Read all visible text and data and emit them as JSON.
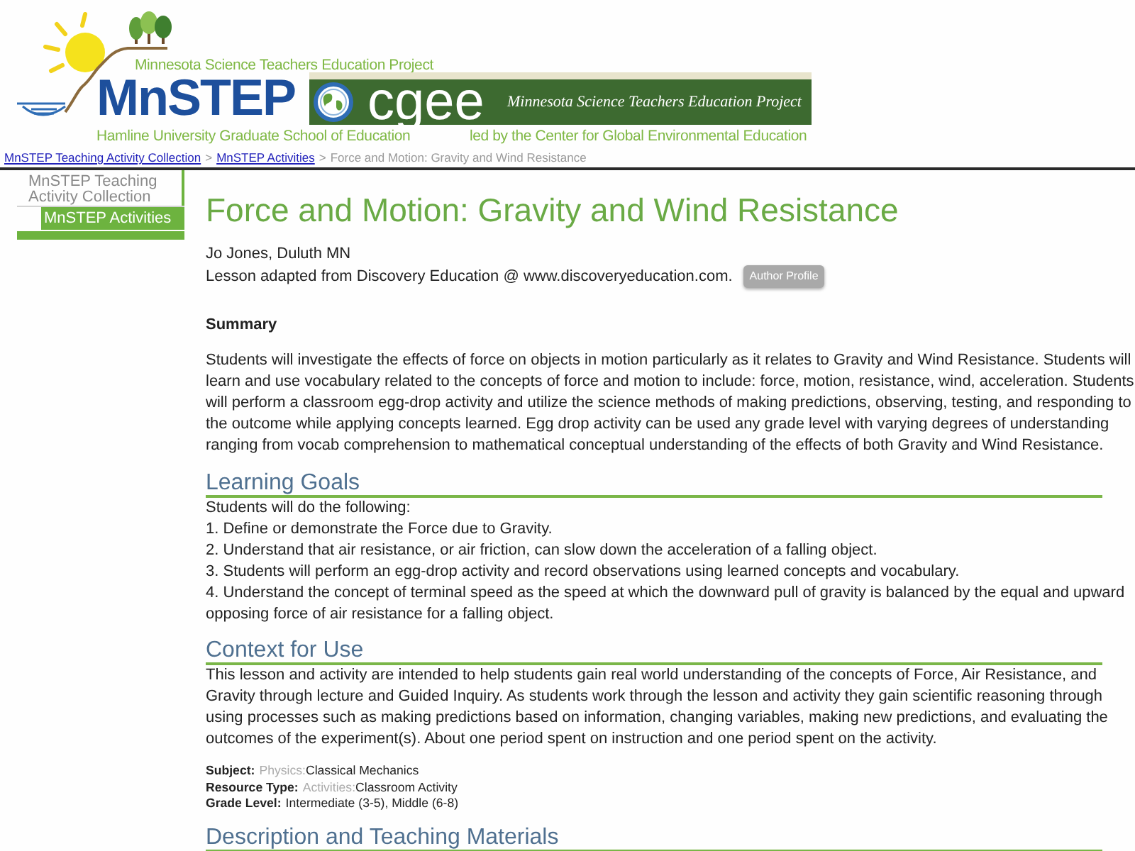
{
  "header": {
    "tagline": "Minnesota Science Teachers Education Project",
    "logo_text": "MnSTEP",
    "banner": {
      "logo_text": "cgee",
      "tagline": "Minnesota Science Teachers Education Project"
    },
    "school": "Hamline University Graduate School of Education",
    "partner": "led by the Center for Global Environmental Education"
  },
  "breadcrumb": [
    {
      "kind": "link",
      "text": "MnSTEP Teaching Activity Collection"
    },
    {
      "kind": "separator",
      "text": ">"
    },
    {
      "kind": "link",
      "text": "MnSTEP Activities"
    },
    {
      "kind": "separator",
      "text": ">"
    },
    {
      "kind": "current",
      "text": "Force and Motion: Gravity and Wind Resistance"
    }
  ],
  "sidebar": {
    "items": [
      {
        "label": "MnSTEP Teaching Activity Collection",
        "selected": false,
        "children": [
          {
            "label": "MnSTEP Activities",
            "selected": true
          }
        ]
      }
    ]
  },
  "page": {
    "title": "Force and Motion: Gravity and Wind Resistance",
    "author": "Jo Jones, Duluth MN",
    "source": "Lesson adapted from Discovery Education @ www.discoveryeducation.com.",
    "author_button": "Author Profile",
    "summary": {
      "heading": "Summary",
      "text": "Students will investigate the effects of force on objects in motion particularly as it relates to Gravity and Wind Resistance. Students will learn and use vocabulary related to the concepts of force and motion to include: force, motion, resistance, wind, acceleration. Students will perform a classroom egg-drop activity and utilize the science methods of making predictions, observing, testing, and responding to the outcome while applying concepts learned. Egg drop activity can be used any grade level with varying degrees of understanding ranging from vocab comprehension to mathematical conceptual understanding of the effects of both Gravity and Wind Resistance."
    },
    "sections": [
      {
        "kind": "list",
        "heading": "Learning Goals",
        "intro": "Students will do the following:",
        "items": [
          "1. Define or demonstrate the Force due to Gravity.",
          "2. Understand that air resistance, or air friction, can slow down the acceleration of a falling object.",
          "3. Students will perform an egg-drop activity and record observations using learned concepts and vocabulary.",
          "4. Understand the concept of terminal speed as the speed at which the downward pull of gravity is balanced by the equal and upward opposing force of air resistance for a falling object."
        ]
      },
      {
        "kind": "text",
        "heading": "Context for Use",
        "text": "This lesson and activity are intended to help students gain real world understanding of the concepts of Force, Air Resistance, and Gravity through lecture and Guided Inquiry. As students work through the lesson and activity they gain scientific reasoning through using processes such as making predictions based on information, changing variables, making new predictions, and evaluating the outcomes of the experiment(s). About one period spent on instruction and one period spent on the activity.",
        "metadata": [
          {
            "label": "Subject:",
            "category": "Physics:",
            "value": "Classical Mechanics"
          },
          {
            "label": "Resource Type:",
            "category": "Activities:",
            "value": "Classroom Activity"
          },
          {
            "label": "Grade Level:",
            "value": "Intermediate (3-5), Middle (6-8)"
          }
        ]
      },
      {
        "kind": "text",
        "heading": "Description and Teaching Materials"
      }
    ]
  }
}
